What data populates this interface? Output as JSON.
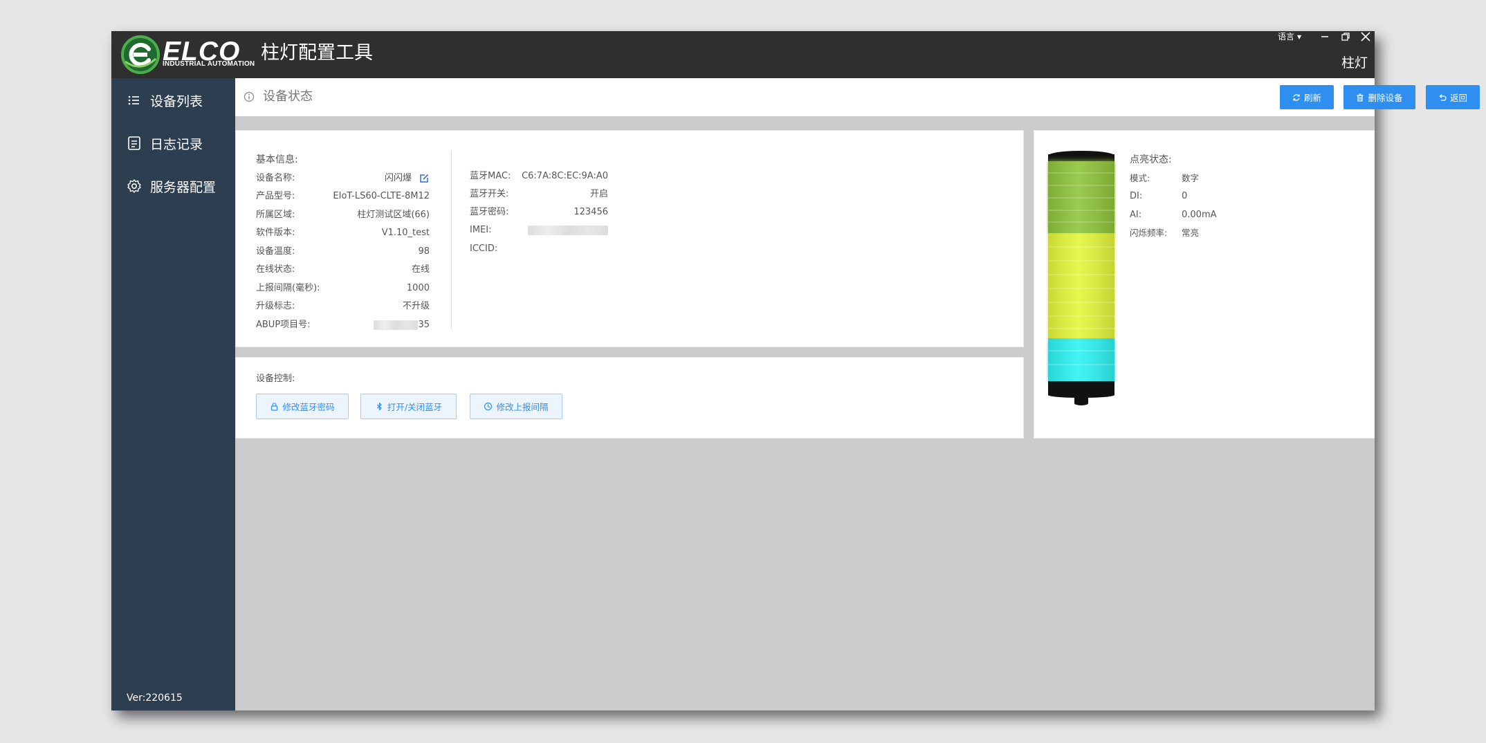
{
  "app": {
    "brand": "ELCO",
    "brand_sub": "INDUSTRIAL AUTOMATION",
    "title": "柱灯配置工具",
    "window_right_title": "柱灯",
    "language_label": "语言"
  },
  "sidebar": {
    "items": [
      {
        "label": "设备列表",
        "icon": "list-icon"
      },
      {
        "label": "日志记录",
        "icon": "log-icon"
      },
      {
        "label": "服务器配置",
        "icon": "gear-icon"
      }
    ],
    "version": "Ver:220615"
  },
  "page": {
    "title": "设备状态",
    "buttons": {
      "refresh": "刷新",
      "delete": "删除设备",
      "back": "返回"
    }
  },
  "basic_info": {
    "section_title": "基本信息:",
    "rows": [
      {
        "label": "设备名称:",
        "value": "闪闪爆"
      },
      {
        "label": "产品型号:",
        "value": "EIoT-LS60-CLTE-8M12"
      },
      {
        "label": "所属区域:",
        "value": "柱灯测试区域(66)"
      },
      {
        "label": "软件版本:",
        "value": "V1.10_test"
      },
      {
        "label": "设备温度:",
        "value": "98"
      },
      {
        "label": "在线状态:",
        "value": "在线"
      },
      {
        "label": "上报间隔(毫秒):",
        "value": "1000"
      },
      {
        "label": "升级标志:",
        "value": "不升级"
      },
      {
        "label": "ABUP项目号:",
        "value": "35"
      }
    ]
  },
  "bluetooth_info": {
    "rows": [
      {
        "label": "蓝牙MAC:",
        "value": "C6:7A:8C:EC:9A:A0"
      },
      {
        "label": "蓝牙开关:",
        "value": "开启"
      },
      {
        "label": "蓝牙密码:",
        "value": "123456"
      },
      {
        "label": "IMEI:",
        "value": ""
      },
      {
        "label": "ICCID:",
        "value": ""
      }
    ]
  },
  "control": {
    "section_title": "设备控制:",
    "buttons": {
      "bt_password": "修改蓝牙密码",
      "bt_toggle": "打开/关闭蓝牙",
      "interval": "修改上报间隔"
    }
  },
  "light_status": {
    "section_title": "点亮状态:",
    "rows": [
      {
        "label": "模式:",
        "value": "数字"
      },
      {
        "label": "DI:",
        "value": "0"
      },
      {
        "label": "AI:",
        "value": "0.00mA"
      },
      {
        "label": "闪烁频率:",
        "value": "常亮"
      }
    ],
    "segment_colors": [
      "#8fc43a",
      "#e4f53a",
      "#2ef2f2"
    ]
  },
  "colors": {
    "accent": "#2f8ff0",
    "sidebar": "#2d3e50",
    "titlebar": "#2f2f2f"
  }
}
